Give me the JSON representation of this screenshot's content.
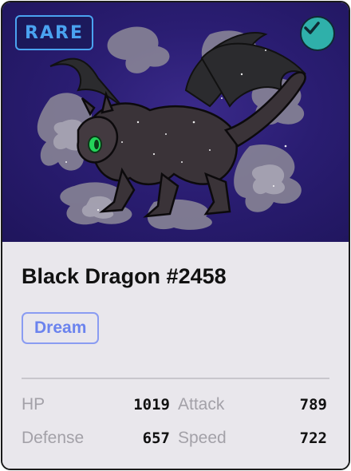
{
  "card": {
    "rarity_label": "RARE",
    "verified_icon": "check-circle-icon",
    "name": "Black Dragon #2458",
    "type_label": "Dream",
    "colors": {
      "rarity": "#4aa3f0",
      "verified": "#2fb0aa",
      "type": "#6b83ee",
      "art_background": "#2a1d72"
    }
  },
  "stats": [
    {
      "label": "HP",
      "value": "1019"
    },
    {
      "label": "Attack",
      "value": "789"
    },
    {
      "label": "Defense",
      "value": "657"
    },
    {
      "label": "Speed",
      "value": "722"
    }
  ]
}
